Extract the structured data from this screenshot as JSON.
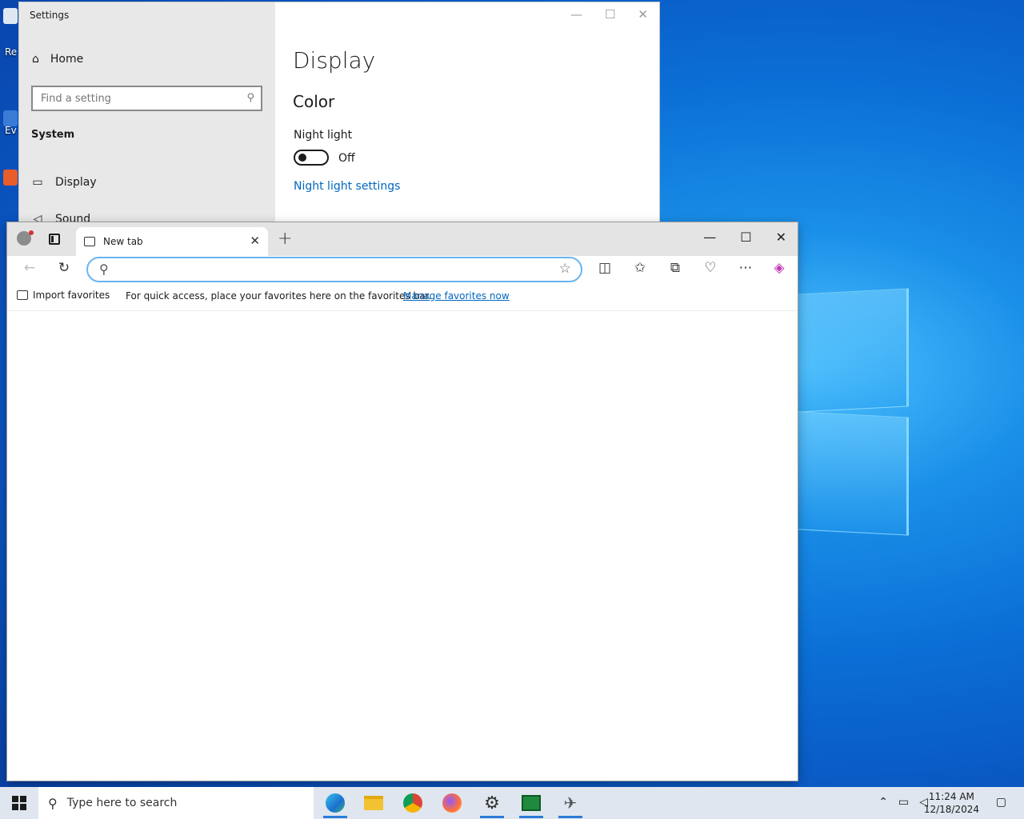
{
  "desktop": {
    "icon_labels": [
      "Re",
      "Ev"
    ]
  },
  "settings": {
    "window_title": "Settings",
    "home_label": "Home",
    "search_placeholder": "Find a setting",
    "section_label": "System",
    "nav_items": [
      {
        "label": "Display",
        "icon": "monitor-icon"
      },
      {
        "label": "Sound",
        "icon": "speaker-icon"
      }
    ],
    "page_title": "Display",
    "group_title": "Color",
    "night_light_label": "Night light",
    "night_light_state": "Off",
    "night_light_on": false,
    "night_light_link": "Night light settings"
  },
  "edge": {
    "tab_title": "New tab",
    "address_value": "",
    "favorites_bar": {
      "import_label": "Import favorites",
      "message": "For quick access, place your favorites here on the favorites bar.",
      "manage_link": "Manage favorites now"
    }
  },
  "taskbar": {
    "search_placeholder": "Type here to search",
    "apps": [
      "edge-icon",
      "file-explorer-icon",
      "chrome-icon",
      "firefox-icon",
      "settings-gear-icon",
      "terminal-icon",
      "airplane-icon"
    ],
    "time": "11:24 AM",
    "date": "12/18/2024"
  },
  "colors": {
    "accent": "#0067c0",
    "address_border": "#6ab4f0"
  }
}
